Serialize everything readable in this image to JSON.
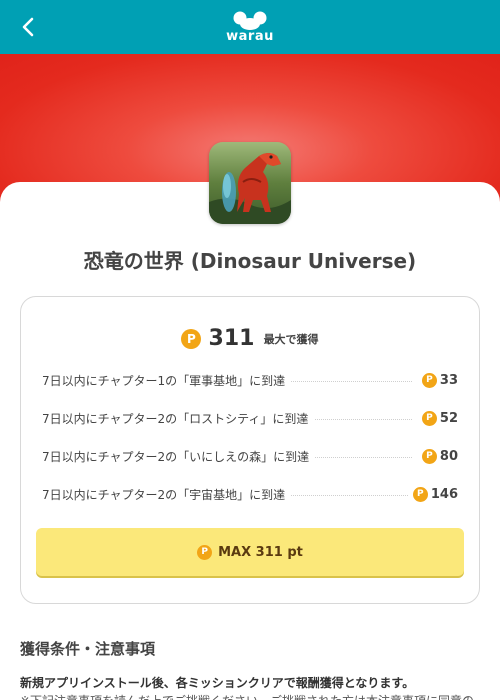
{
  "header": {
    "back_icon": "chevron-left-icon",
    "logo_text": "warau"
  },
  "app": {
    "title": "恐竜の世界 (Dinosaur Universe)"
  },
  "reward_summary": {
    "max_points": "311",
    "max_suffix": "最大で獲得"
  },
  "missions": [
    {
      "label": "7日以内にチャプター1の「軍事基地」に到達",
      "points": "33"
    },
    {
      "label": "7日以内にチャプター2の「ロストシティ」に到達",
      "points": "52"
    },
    {
      "label": "7日以内にチャプター2の「いにしえの森」に到達",
      "points": "80"
    },
    {
      "label": "7日以内にチャプター2の「宇宙基地」に到達",
      "points": "146"
    }
  ],
  "point_symbol": "P",
  "cta": {
    "label": "MAX 311 pt"
  },
  "conditions": {
    "title": "獲得条件・注意事項",
    "line1": "新規アプリインストール後、各ミッションクリアで報酬獲得となります。",
    "line2": "※下記注意事項を読んだ上でご挑戦ください。ご挑戦された方は本注意事項に同意の"
  },
  "colors": {
    "header_bg": "#00a0b4",
    "hero_red": "#e42a1e",
    "point_gold": "#f2a516",
    "cta_yellow": "#fbe87a"
  }
}
